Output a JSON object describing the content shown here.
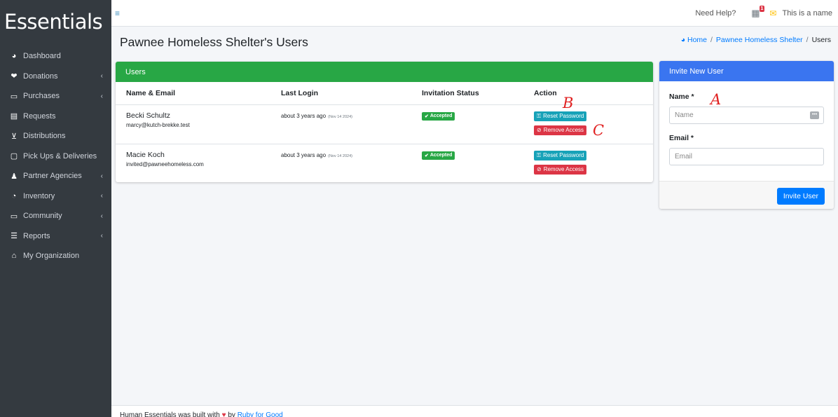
{
  "brand": "Essentials",
  "sidebar": {
    "items": [
      {
        "label": "Dashboard",
        "icon": "tachometer-icon",
        "glyph": "◕",
        "has_chevron": false
      },
      {
        "label": "Donations",
        "icon": "heart-circle-icon",
        "glyph": "❤",
        "has_chevron": true
      },
      {
        "label": "Purchases",
        "icon": "money-bill-icon",
        "glyph": "▭",
        "has_chevron": true
      },
      {
        "label": "Requests",
        "icon": "file-icon",
        "glyph": "▤",
        "has_chevron": false
      },
      {
        "label": "Distributions",
        "icon": "cart-icon",
        "glyph": "⊻",
        "has_chevron": false
      },
      {
        "label": "Pick Ups & Deliveries",
        "icon": "calendar-icon",
        "glyph": "▢",
        "has_chevron": false
      },
      {
        "label": "Partner Agencies",
        "icon": "users-icon",
        "glyph": "♟",
        "has_chevron": true
      },
      {
        "label": "Inventory",
        "icon": "pie-chart-icon",
        "glyph": "◔",
        "has_chevron": true
      },
      {
        "label": "Community",
        "icon": "laptop-icon",
        "glyph": "▭",
        "has_chevron": true
      },
      {
        "label": "Reports",
        "icon": "list-icon",
        "glyph": "☰",
        "has_chevron": true
      },
      {
        "label": "My Organization",
        "icon": "home-icon",
        "glyph": "⌂",
        "has_chevron": false
      }
    ],
    "chevron": "‹"
  },
  "navbar": {
    "menu_glyph": "≡",
    "help": "Need Help?",
    "notification_count": "1",
    "username": "This is a name"
  },
  "page": {
    "title": "Pawnee Homeless Shelter's Users",
    "breadcrumb": {
      "home": "Home",
      "org": "Pawnee Homeless Shelter",
      "sep": "/",
      "current": "Users"
    }
  },
  "users_card": {
    "header": "Users",
    "columns": [
      "Name & Email",
      "Last Login",
      "Invitation Status",
      "Action"
    ],
    "rows": [
      {
        "name": "Becki Schultz",
        "email": "marcy@kutch-brekke.test",
        "last_login": "about 3 years ago",
        "last_login_date": "(Nov 14 2024)",
        "status": "Accepted",
        "reset_label": "Reset Password",
        "remove_label": "Remove Access"
      },
      {
        "name": "Macie Koch",
        "email": "invited@pawneehomeless.com",
        "last_login": "about 3 years ago",
        "last_login_date": "(Nov 14 2024)",
        "status": "Accepted",
        "reset_label": "Reset Password",
        "remove_label": "Remove Access"
      }
    ]
  },
  "invite_card": {
    "header": "Invite New User",
    "name_label": "Name *",
    "name_placeholder": "Name",
    "email_label": "Email *",
    "email_placeholder": "Email",
    "submit_label": "Invite User"
  },
  "footer": {
    "text_start": "Human Essentials was built with",
    "text_by": "by",
    "org_link": "Ruby for Good"
  },
  "annotations": {
    "a": "A",
    "b": "B",
    "c": "C",
    "color": "#e02020"
  }
}
